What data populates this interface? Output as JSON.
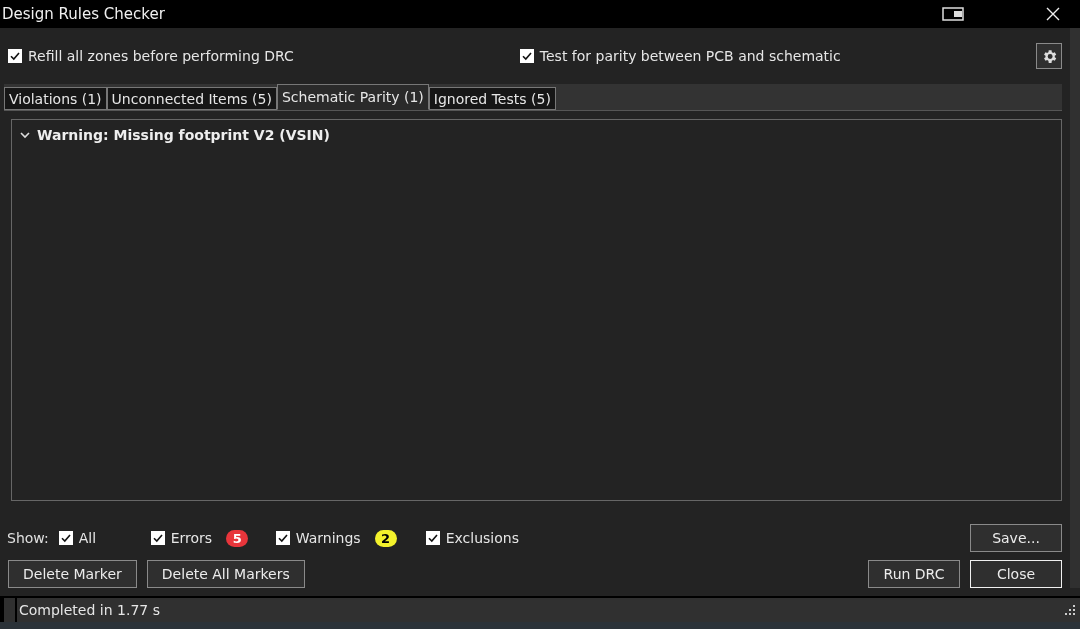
{
  "window": {
    "title": "Design Rules Checker"
  },
  "options": [
    {
      "label": "Refill all zones before performing DRC",
      "checked": true
    },
    {
      "label": "Test for parity between PCB and schematic",
      "checked": true
    }
  ],
  "tabs": [
    {
      "label": "Violations (1)",
      "selected": false
    },
    {
      "label": "Unconnected Items (5)",
      "selected": false
    },
    {
      "label": "Schematic Parity (1)",
      "selected": true
    },
    {
      "label": "Ignored Tests (5)",
      "selected": false
    }
  ],
  "tree": [
    {
      "text": "Warning: Missing footprint V2 (VSIN)",
      "expanded": true
    }
  ],
  "show_label": "Show:",
  "filters": [
    {
      "label": "All",
      "checked": true
    },
    {
      "label": "Errors",
      "checked": true,
      "badge": "5",
      "color": "#e8353b"
    },
    {
      "label": "Warnings",
      "checked": true,
      "badge": "2",
      "color": "#f4f22c"
    },
    {
      "label": "Exclusions",
      "checked": true
    }
  ],
  "save_button": "Save...",
  "buttons_left": [
    "Delete Marker",
    "Delete All Markers"
  ],
  "buttons_right": [
    {
      "label": "Run DRC",
      "focused": false
    },
    {
      "label": "Close",
      "focused": true
    }
  ],
  "status_bar": "Completed in 1.77 s"
}
